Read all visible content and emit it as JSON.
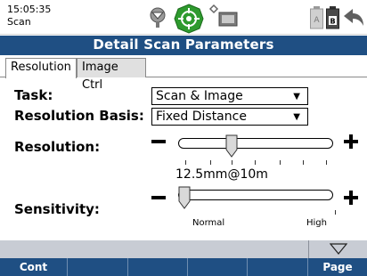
{
  "status_bar": {
    "time": "15:05:35",
    "app_name": "Scan",
    "icons": [
      "prism-icon",
      "gps-target-icon",
      "wireless-connection-icon",
      "battery-a-icon",
      "battery-b-icon",
      "back-arrow-icon"
    ]
  },
  "title": "Detail Scan Parameters",
  "tabs": [
    {
      "label": "Resolution",
      "active": true
    },
    {
      "label": "Image Ctrl",
      "active": false
    }
  ],
  "form": {
    "task": {
      "label": "Task:",
      "value": "Scan & Image"
    },
    "resolution_basis": {
      "label": "Resolution Basis:",
      "value": "Fixed Distance"
    },
    "resolution": {
      "label": "Resolution:",
      "value_text": "12.5mm@10m",
      "slider_fraction": 0.33
    },
    "sensitivity": {
      "label": "Sensitivity:",
      "low_label": "Normal",
      "high_label": "High",
      "slider_fraction": 0.0
    }
  },
  "softkeys": [
    "Cont",
    "",
    "",
    "",
    "",
    "Page"
  ],
  "colors": {
    "title_bar": "#1f4f83",
    "accent_green": "#2e9a2e",
    "bottom_strip": "#c8ccd4"
  }
}
